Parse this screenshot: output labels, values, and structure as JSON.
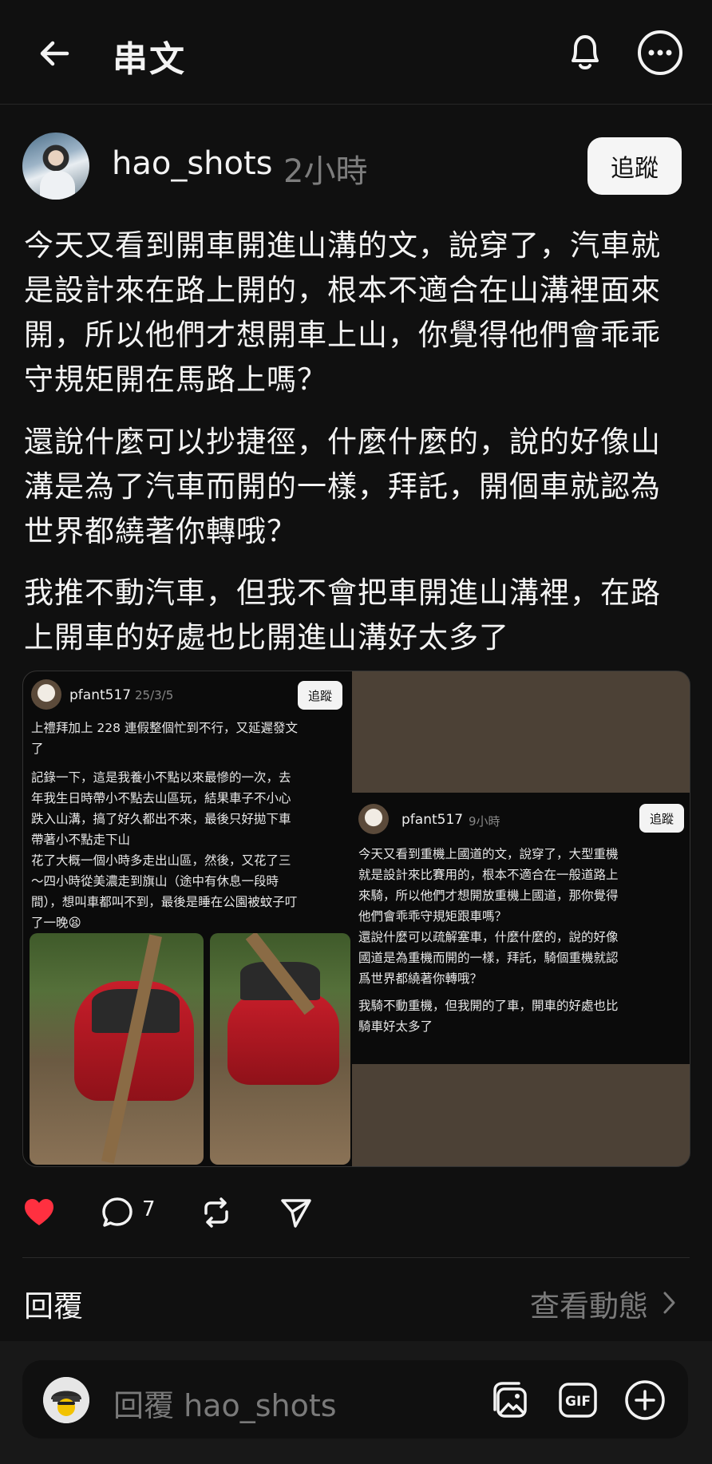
{
  "header": {
    "title": "串文"
  },
  "post": {
    "username": "hao_shots",
    "time": "2小時",
    "follow_label": "追蹤",
    "paragraphs": [
      "今天又看到開車開進山溝的文，說穿了，汽車就是設計來在路上開的，根本不適合在山溝裡面來開，所以他們才想開車上山，你覺得他們會乖乖守規矩開在馬路上嗎？",
      "還說什麼可以抄捷徑，什麼什麼的，說的好像山溝是為了汽車而開的一樣，拜託，開個車就認為世界都繞著你轉哦？",
      "我推不動汽車，但我不會把車開進山溝裡，在路上開車的好處也比開進山溝好太多了"
    ]
  },
  "embedded": {
    "left": {
      "username": "pfant517",
      "time": "25/3/5",
      "follow_label": "追蹤",
      "text_lines": [
        "上禮拜加上 228 連假整個忙到不行，又延遲發文",
        "了",
        "",
        "記錄一下，這是我養小不點以來最慘的一次，去",
        "年我生日時帶小不點去山區玩，結果車子不小心",
        "跌入山溝，搞了好久都出不來，最後只好拋下車",
        "帶著小不點走下山",
        "花了大概一個小時多走出山區，然後，又花了三",
        "～四小時從美濃走到旗山（途中有休息一段時",
        "間），想叫車都叫不到，最後是睡在公園被蚊子叮",
        "了一晚😫"
      ]
    },
    "right": {
      "username": "pfant517",
      "time": "9小時",
      "follow_label": "追蹤",
      "text_lines": [
        "今天又看到重機上國道的文，說穿了，大型重機",
        "就是設計來比賽用的，根本不適合在一般道路上",
        "來騎，所以他們才想開放重機上國道，那你覺得",
        "他們會乖乖守規矩跟車嗎？",
        "還說什麼可以疏解塞車，什麼什麼的，說的好像",
        "國道是為重機而開的一樣，拜託，騎個重機就認",
        "爲世界都繞著你轉哦？",
        "",
        "我騎不動重機，但我開的了車，開車的好處也比",
        "騎車好太多了"
      ]
    }
  },
  "actions": {
    "comment_count": "7",
    "liked": true
  },
  "footer": {
    "reply_label": "回覆",
    "view_activity": "查看動態"
  },
  "composer": {
    "placeholder": "回覆 hao_shots"
  },
  "colors": {
    "like": "#ff3040",
    "background": "#101010"
  }
}
